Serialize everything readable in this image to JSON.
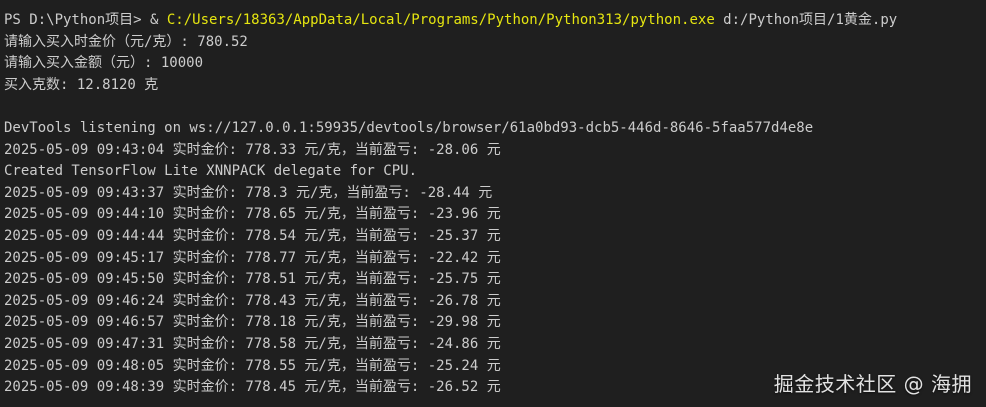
{
  "terminal": {
    "command": {
      "prompt": "PS D:\\Python项目> ",
      "operator": "& ",
      "executable": "C:/Users/18363/AppData/Local/Programs/Python/Python313/python.exe",
      "argument": " d:/Python项目/1黄金.py"
    },
    "lines": [
      "请输入买入时金价（元/克）: 780.52",
      "请输入买入金额（元）: 10000",
      "买入克数: 12.8120 克",
      "",
      "DevTools listening on ws://127.0.0.1:59935/devtools/browser/61a0bd93-dcb5-446d-8646-5faa577d4e8e",
      "2025-05-09 09:43:04 实时金价: 778.33 元/克，当前盈亏: -28.06 元",
      "Created TensorFlow Lite XNNPACK delegate for CPU.",
      "2025-05-09 09:43:37 实时金价: 778.3 元/克，当前盈亏: -28.44 元",
      "2025-05-09 09:44:10 实时金价: 778.65 元/克，当前盈亏: -23.96 元",
      "2025-05-09 09:44:44 实时金价: 778.54 元/克，当前盈亏: -25.37 元",
      "2025-05-09 09:45:17 实时金价: 778.77 元/克，当前盈亏: -22.42 元",
      "2025-05-09 09:45:50 实时金价: 778.51 元/克，当前盈亏: -25.75 元",
      "2025-05-09 09:46:24 实时金价: 778.43 元/克，当前盈亏: -26.78 元",
      "2025-05-09 09:46:57 实时金价: 778.18 元/克，当前盈亏: -29.98 元",
      "2025-05-09 09:47:31 实时金价: 778.58 元/克，当前盈亏: -24.86 元",
      "2025-05-09 09:48:05 实时金价: 778.55 元/克，当前盈亏: -25.24 元",
      "2025-05-09 09:48:39 实时金价: 778.45 元/克，当前盈亏: -26.52 元"
    ]
  },
  "watermark": "掘金技术社区 @ 海拥",
  "colors": {
    "background": "#1f1f1f",
    "text": "#cccccc",
    "executable_highlight": "#e5e510"
  }
}
